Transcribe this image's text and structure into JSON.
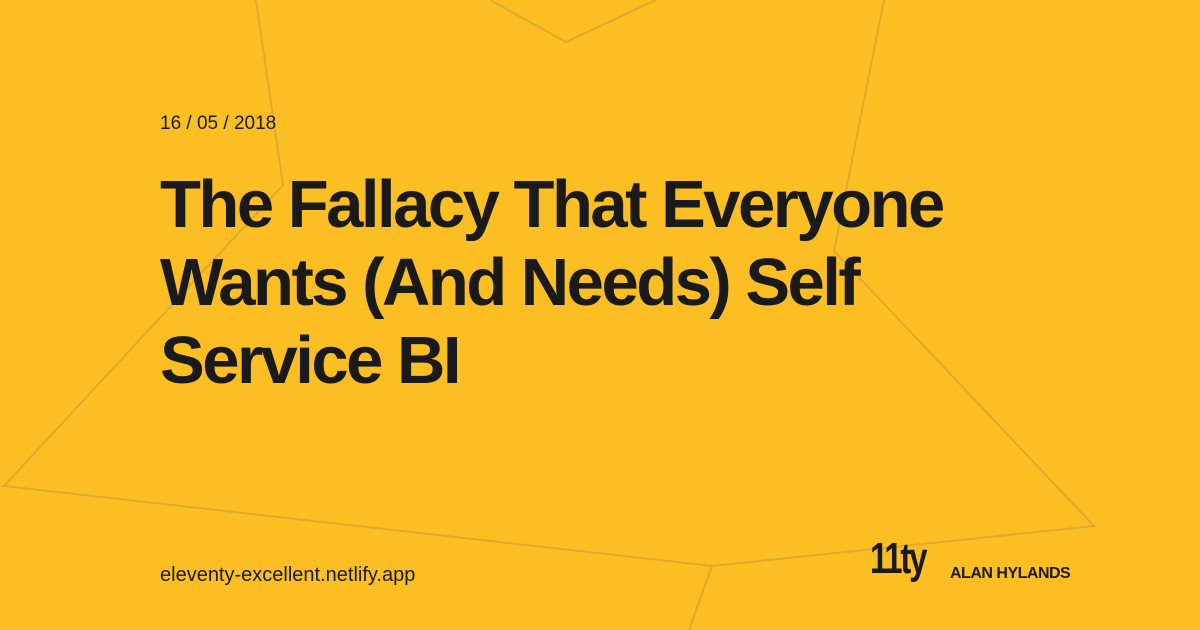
{
  "date": "16 / 05 / 2018",
  "title": "The Fallacy That Everyone Wants (And Needs) Self Service BI",
  "site_url": "eleventy-excellent.netlify.app",
  "logo_text": "11ty",
  "author": "ALAN HYLANDS",
  "colors": {
    "background": "#fbbf24",
    "text": "#1a1a1a",
    "star_outline": "#e0ab2a"
  }
}
